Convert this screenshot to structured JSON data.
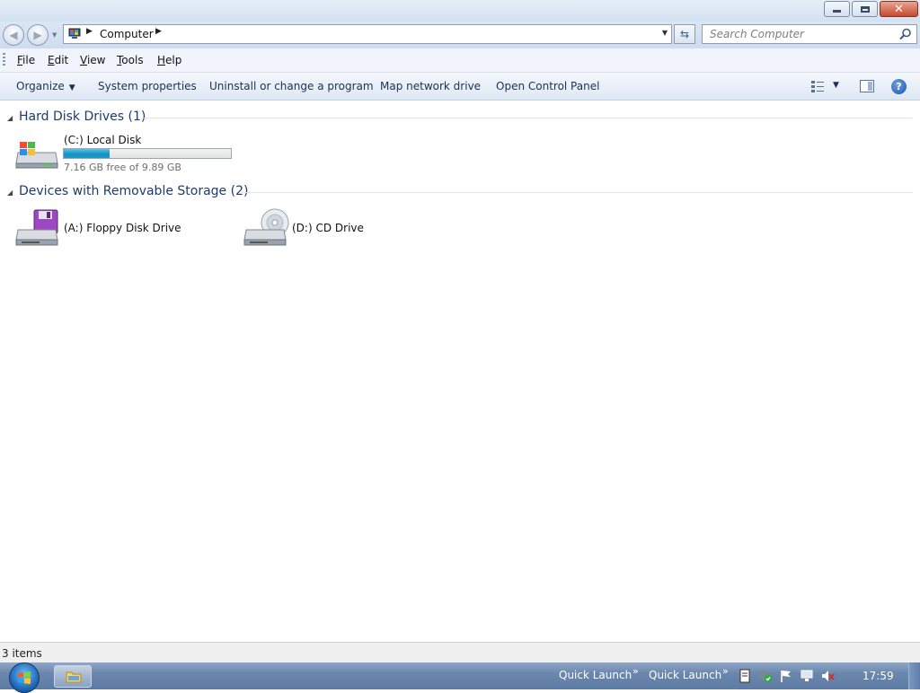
{
  "window": {
    "caption_buttons": {
      "minimize": "minimize",
      "maximize": "restore",
      "close": "close"
    }
  },
  "address_bar": {
    "location": "Computer",
    "search_placeholder": "Search Computer"
  },
  "menu": [
    "File",
    "Edit",
    "View",
    "Tools",
    "Help"
  ],
  "command_bar": {
    "organize": "Organize",
    "system_properties": "System properties",
    "uninstall": "Uninstall or change a program",
    "map_drive": "Map network drive",
    "control_panel": "Open Control Panel"
  },
  "groups": {
    "hard_disks": {
      "title": "Hard Disk Drives (1)",
      "drives": [
        {
          "name": "(C:) Local Disk",
          "free_text": "7.16 GB free of 9.89 GB",
          "used_fraction": 0.276
        }
      ]
    },
    "removable": {
      "title": "Devices with Removable Storage (2)",
      "drives": [
        {
          "name": "(A:) Floppy Disk Drive"
        },
        {
          "name": "(D:) CD Drive"
        }
      ]
    }
  },
  "status": {
    "items": "3 items"
  },
  "taskbar": {
    "quick_launch_1": "Quick Launch",
    "quick_launch_2": "Quick Launch",
    "clock": "17:59"
  },
  "colors": {
    "accent": "#1e3a6e",
    "capacity_fill": "#1e9ccc",
    "taskbar": "#6b87ad"
  }
}
